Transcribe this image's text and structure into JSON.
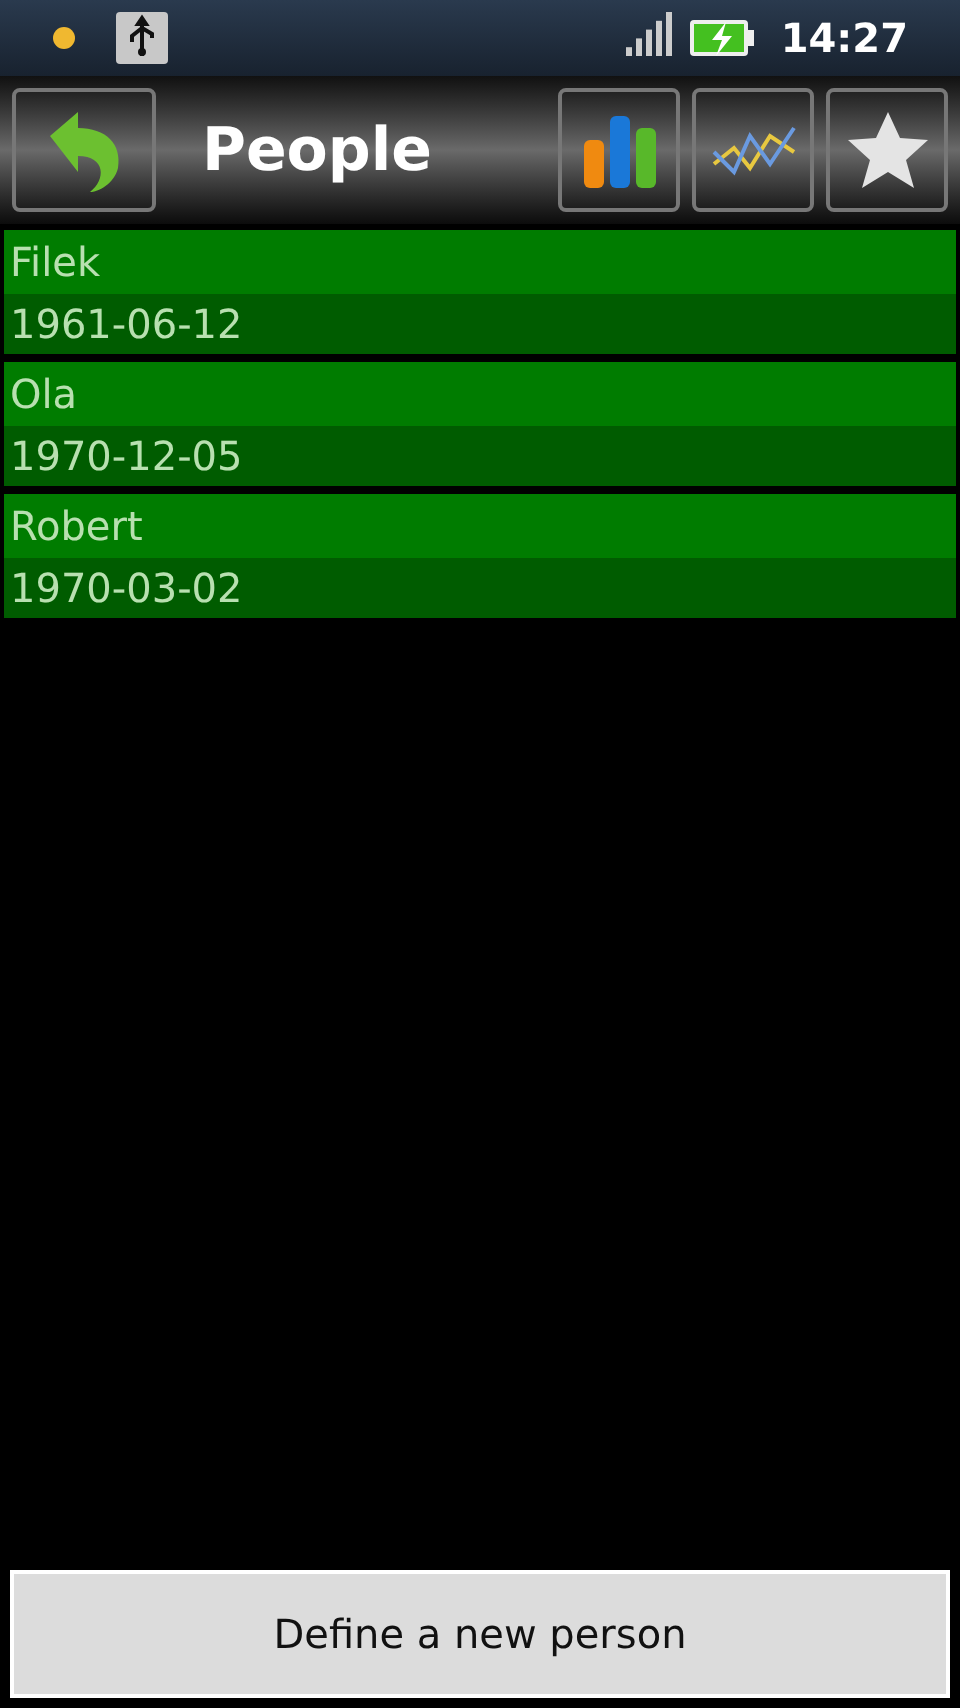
{
  "status_bar": {
    "time": "14:27"
  },
  "header": {
    "title": "People"
  },
  "people": [
    {
      "name": "Filek",
      "date": "1961-06-12"
    },
    {
      "name": "Ola",
      "date": "1970-12-05"
    },
    {
      "name": "Robert",
      "date": "1970-03-02"
    }
  ],
  "footer_button": "Define a new person"
}
